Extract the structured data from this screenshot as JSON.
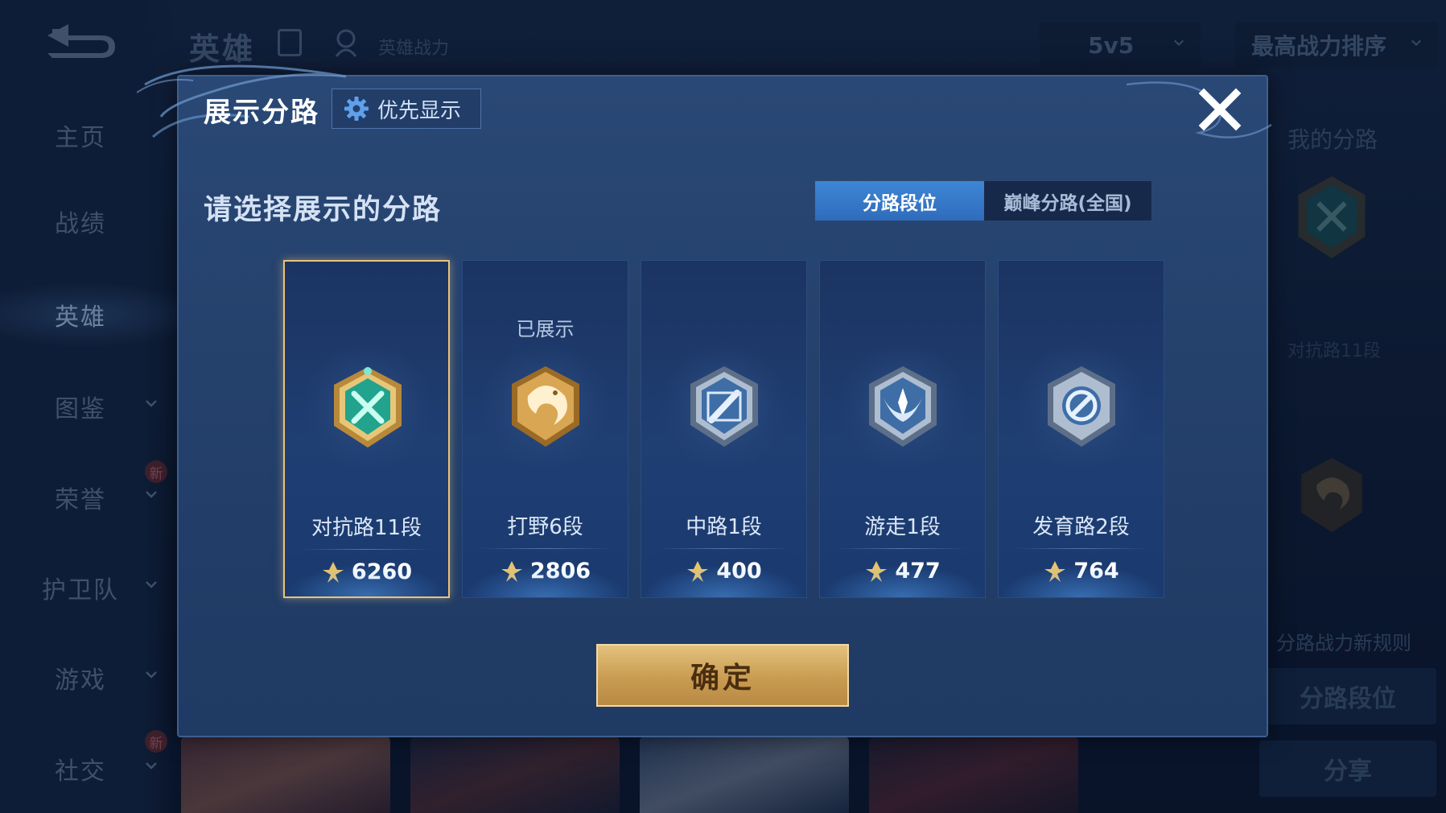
{
  "background": {
    "sidebar": {
      "items": [
        {
          "label": "主页"
        },
        {
          "label": "战绩"
        },
        {
          "label": "英雄"
        },
        {
          "label": "图鉴"
        },
        {
          "label": "荣誉",
          "badge": "新"
        },
        {
          "label": "护卫队"
        },
        {
          "label": "游戏"
        },
        {
          "label": "社交",
          "badge": "新"
        }
      ]
    },
    "header": {
      "title": "英雄",
      "power_label": "英雄战力",
      "mode": "5v5",
      "sort": "最高战力排序"
    },
    "right_panel": {
      "title": "我的分路",
      "rank": "对抗路11段",
      "rule_link": "分路战力新规则",
      "lane_button": "分路段位",
      "share_button": "分享"
    }
  },
  "modal": {
    "title": "展示分路",
    "priority_button": "优先显示",
    "subtitle": "请选择展示的分路",
    "tabs": [
      {
        "label": "分路段位",
        "active": true
      },
      {
        "label": "巅峰分路(全国)",
        "active": false
      }
    ],
    "cards": [
      {
        "name": "对抗路11段",
        "score": "6260",
        "shown": "",
        "selected": true,
        "emblem": "clash-lane-emblem"
      },
      {
        "name": "打野6段",
        "score": "2806",
        "shown": "已展示",
        "selected": false,
        "emblem": "jungle-emblem"
      },
      {
        "name": "中路1段",
        "score": "400",
        "shown": "",
        "selected": false,
        "emblem": "mid-lane-emblem"
      },
      {
        "name": "游走1段",
        "score": "477",
        "shown": "",
        "selected": false,
        "emblem": "roam-emblem"
      },
      {
        "name": "发育路2段",
        "score": "764",
        "shown": "",
        "selected": false,
        "emblem": "farm-lane-emblem"
      }
    ],
    "confirm_button": "确定"
  },
  "colors": {
    "accent_blue": "#3e86d6",
    "gold": "#e9c27a",
    "modal_bg": "#24416c"
  }
}
